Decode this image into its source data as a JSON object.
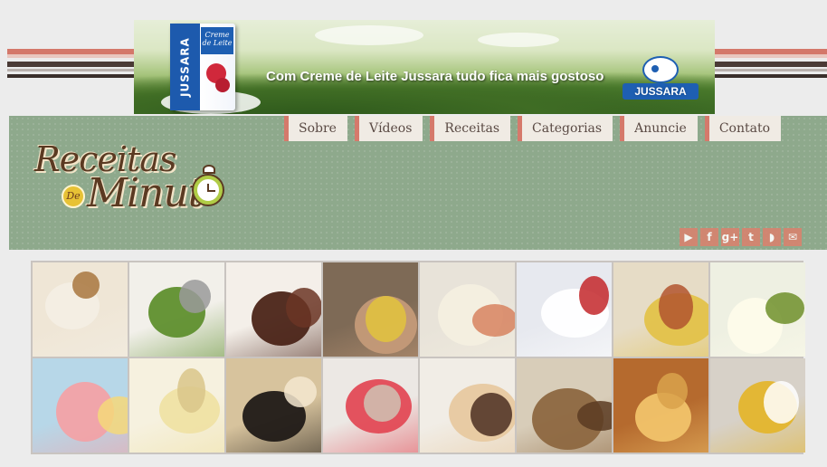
{
  "ad": {
    "tagline": "Com Creme de Leite Jussara tudo fica mais gostoso",
    "carton_side": "JUSSARA",
    "carton_front": "Creme de Leite",
    "brand": "JUSSARA"
  },
  "logo": {
    "line1": "Receitas",
    "de": "De",
    "line2": "Minut"
  },
  "nav": {
    "items": [
      "Sobre",
      "Vídeos",
      "Receitas",
      "Categorias",
      "Anuncie",
      "Contato"
    ]
  },
  "social": [
    {
      "name": "youtube-icon",
      "glyph": "▶"
    },
    {
      "name": "facebook-icon",
      "glyph": "f"
    },
    {
      "name": "google-plus-icon",
      "glyph": "g+"
    },
    {
      "name": "tumblr-icon",
      "glyph": "t"
    },
    {
      "name": "rss-icon",
      "glyph": "◗"
    },
    {
      "name": "email-icon",
      "glyph": "✉"
    }
  ],
  "gallery": {
    "tiles": [
      {
        "name": "tile-salpicao-sandwich",
        "colors": [
          "#efe6d6",
          "#f3eee4",
          "#a8753e"
        ]
      },
      {
        "name": "tile-broccoli",
        "colors": [
          "#f2f0ea",
          "#5f8f2e",
          "#9a9a9a"
        ]
      },
      {
        "name": "tile-chocolate-cake",
        "colors": [
          "#f4efe9",
          "#4b2418",
          "#6b3524"
        ]
      },
      {
        "name": "tile-chocolate-drink",
        "colors": [
          "#7e6a56",
          "#c49a78",
          "#e2c33d"
        ]
      },
      {
        "name": "tile-cream-soup",
        "colors": [
          "#e8e3d9",
          "#f4efe0",
          "#d7825f"
        ]
      },
      {
        "name": "tile-salad",
        "colors": [
          "#e7e9ef",
          "#ffffff",
          "#c3272a"
        ]
      },
      {
        "name": "tile-granola",
        "colors": [
          "#e6dcc6",
          "#e3c24a",
          "#b2552e"
        ]
      },
      {
        "name": "tile-kiwi-drink",
        "colors": [
          "#eef0e2",
          "#fdfbea",
          "#6f8f2a"
        ]
      },
      {
        "name": "tile-pink-juice",
        "colors": [
          "#b7d7e8",
          "#f2a2a6",
          "#f5d87a"
        ]
      },
      {
        "name": "tile-pudding",
        "colors": [
          "#f6f1df",
          "#efe1a4",
          "#d9c58a"
        ]
      },
      {
        "name": "tile-sausage-rolls",
        "colors": [
          "#d7c39d",
          "#201a17",
          "#f4e7d0"
        ]
      },
      {
        "name": "tile-watermelon-drink",
        "colors": [
          "#ece8e4",
          "#e34a56",
          "#cfc3b4"
        ]
      },
      {
        "name": "tile-sandwich",
        "colors": [
          "#f1ede6",
          "#e7c9a0",
          "#4b2f22"
        ]
      },
      {
        "name": "tile-mushroom-stew",
        "colors": [
          "#d8cdb9",
          "#8d6740",
          "#5a3b22"
        ]
      },
      {
        "name": "tile-cheese",
        "colors": [
          "#b56a2e",
          "#f1c36a",
          "#d9a24b"
        ]
      },
      {
        "name": "tile-yellow-soup",
        "colors": [
          "#d7d1c8",
          "#e4b52d",
          "#ffffff"
        ]
      }
    ]
  }
}
